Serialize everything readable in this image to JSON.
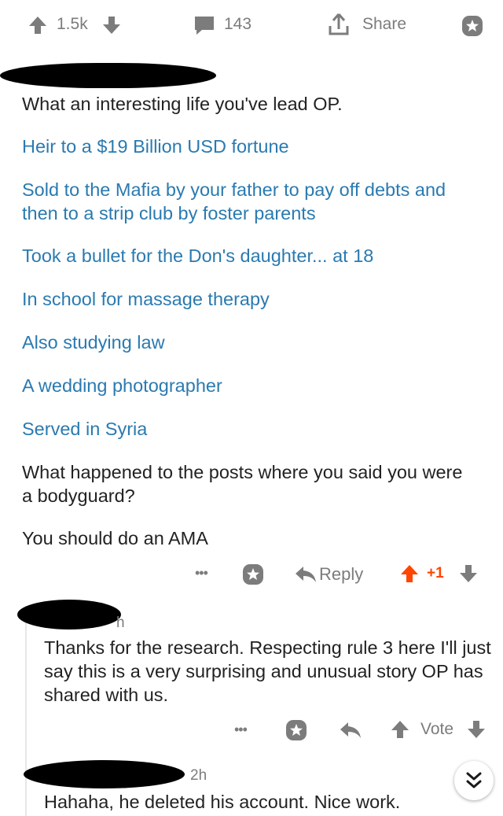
{
  "post_bar": {
    "score": "1.5k",
    "comments": "143",
    "share_label": "Share"
  },
  "comment1": {
    "paragraphs": [
      "What an interesting life you've lead OP."
    ],
    "links": [
      "Heir to a $19 Billion USD fortune",
      "Sold to the Mafia by your father to pay off debts and then to a strip club by foster parents",
      "Took a bullet for the Don's daughter... at 18",
      "In school for massage therapy",
      "Also studying law",
      "A wedding photographer",
      "Served in Syria"
    ],
    "after": [
      "What happened to the posts where you said you were a bodyguard?",
      "You should do an AMA"
    ],
    "reply_label": "Reply",
    "score": "+1",
    "more": "•••"
  },
  "comment2": {
    "age_fragment": "h",
    "text": "Thanks for the research. Respecting rule 3 here I'll just say this is a very surprising and unusual story OP has shared with us.",
    "vote_label": "Vote",
    "more": "•••"
  },
  "comment3": {
    "age": "2h",
    "text": "Hahaha, he deleted his account. Nice work."
  },
  "colors": {
    "link": "#2a7ab0",
    "upvote_active": "#ff4500",
    "gray": "#7c7c7c"
  }
}
